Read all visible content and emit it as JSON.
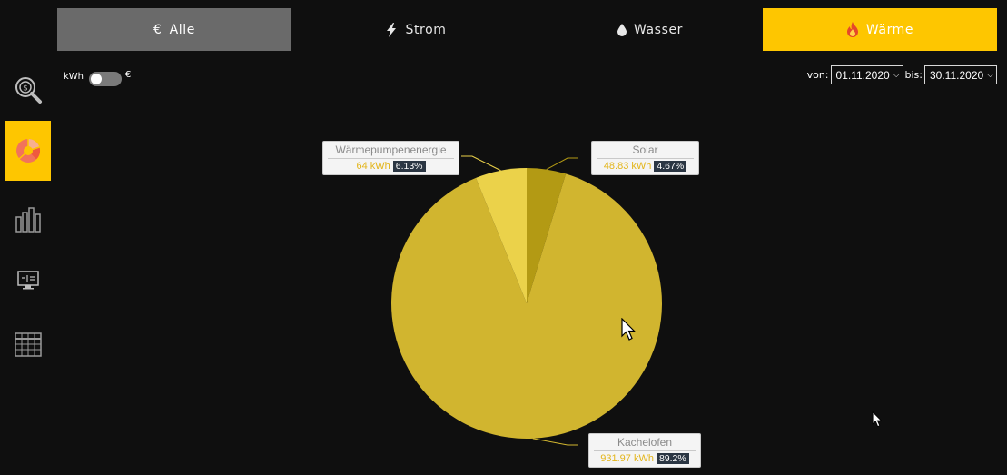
{
  "tabs": [
    {
      "id": "alle",
      "icon": "euro-icon",
      "icon_glyph": "€",
      "label": "Alle"
    },
    {
      "id": "strom",
      "icon": "lightning-icon",
      "label": "Strom"
    },
    {
      "id": "wasser",
      "icon": "water-drop-icon",
      "label": "Wasser"
    },
    {
      "id": "waerme",
      "icon": "flame-icon",
      "label": "Wärme"
    }
  ],
  "active_tab": "waerme",
  "sidebar": [
    {
      "name": "sidebar-item-analysis",
      "icon": "magnifier-coin-icon"
    },
    {
      "name": "sidebar-item-pie-chart",
      "icon": "pie-chart-icon",
      "active": true
    },
    {
      "name": "sidebar-item-bar-chart",
      "icon": "bar-chart-icon"
    },
    {
      "name": "sidebar-item-monitor",
      "icon": "monitor-icon"
    },
    {
      "name": "sidebar-item-table",
      "icon": "table-icon"
    }
  ],
  "unit_toggle": {
    "left": "kWh",
    "right": "€",
    "state": "kWh"
  },
  "date_range": {
    "from_label": "von:",
    "from": "01.11.2020",
    "to_label": "bis:",
    "to": "30.11.2020"
  },
  "colors": {
    "accent": "#fec600",
    "slice_main": "#d1b52f",
    "slice_heat_pump": "#ebd24a",
    "slice_solar": "#b39a14",
    "background": "#0f0f0f"
  },
  "chart_data": {
    "type": "pie",
    "title": "",
    "slices": [
      {
        "label": "Solar",
        "value": 48.83,
        "value_text": "48.83 kWh",
        "percent": 4.67,
        "percent_text": "4.67%"
      },
      {
        "label": "Kachelofen",
        "value": 931.97,
        "value_text": "931.97 kWh",
        "percent": 89.2,
        "percent_text": "89.2%"
      },
      {
        "label": "Wärmepumpenenergie",
        "value": 64,
        "value_text": "64 kWh",
        "percent": 6.13,
        "percent_text": "6.13%"
      }
    ]
  }
}
